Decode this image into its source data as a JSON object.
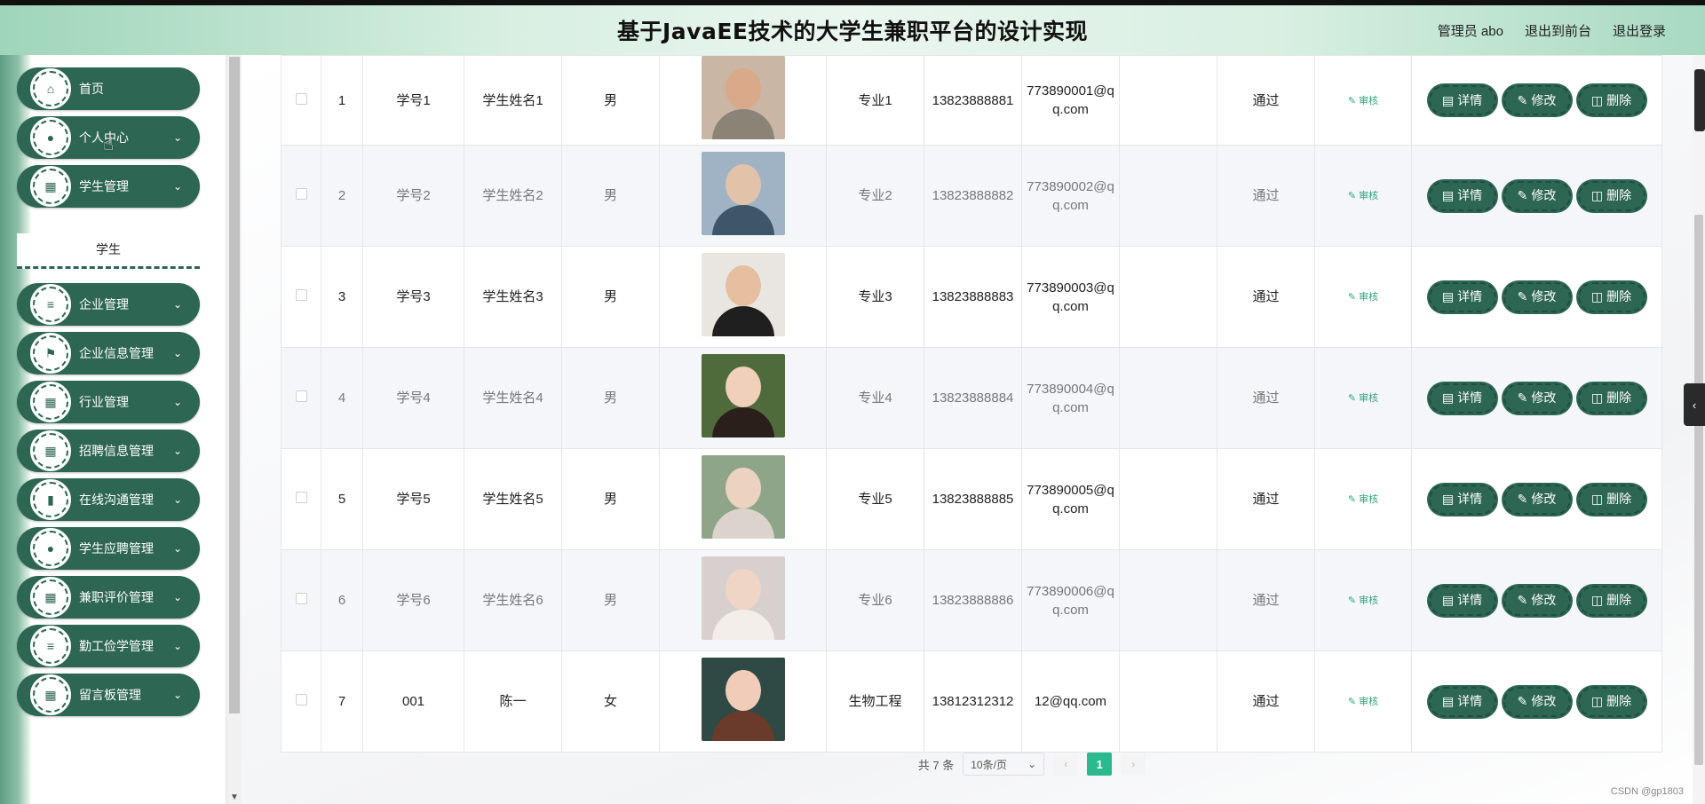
{
  "header": {
    "title": "基于JavaEE技术的大学生兼职平台的设计实现",
    "admin": "管理员 abo",
    "back_front": "退出到前台",
    "logout": "退出登录"
  },
  "sidebar": {
    "items": [
      {
        "label": "首页",
        "icon": "home-icon",
        "chevron": false
      },
      {
        "label": "个人中心",
        "icon": "user-icon",
        "chevron": true
      },
      {
        "label": "学生管理",
        "icon": "grid-icon",
        "chevron": true
      },
      {
        "label": "企业管理",
        "icon": "list-icon",
        "chevron": true
      },
      {
        "label": "企业信息管理",
        "icon": "flag-icon",
        "chevron": true
      },
      {
        "label": "行业管理",
        "icon": "grid-icon",
        "chevron": true
      },
      {
        "label": "招聘信息管理",
        "icon": "grid-icon",
        "chevron": true
      },
      {
        "label": "在线沟通管理",
        "icon": "bar-chart-icon",
        "chevron": true
      },
      {
        "label": "学生应聘管理",
        "icon": "user-icon",
        "chevron": true
      },
      {
        "label": "兼职评价管理",
        "icon": "grid-icon",
        "chevron": true
      },
      {
        "label": "勤工俭学管理",
        "icon": "list-icon",
        "chevron": true
      },
      {
        "label": "留言板管理",
        "icon": "grid-icon",
        "chevron": true
      }
    ],
    "submenu_student": "学生"
  },
  "table": {
    "rows": [
      {
        "no": "1",
        "student_no": "学号1",
        "name": "学生姓名1",
        "gender": "男",
        "major": "专业1",
        "phone": "13823888881",
        "email": "773890001@qq.com",
        "status": "通过",
        "audit": "审核"
      },
      {
        "no": "2",
        "student_no": "学号2",
        "name": "学生姓名2",
        "gender": "男",
        "major": "专业2",
        "phone": "13823888882",
        "email": "773890002@qq.com",
        "status": "通过",
        "audit": "审核"
      },
      {
        "no": "3",
        "student_no": "学号3",
        "name": "学生姓名3",
        "gender": "男",
        "major": "专业3",
        "phone": "13823888883",
        "email": "773890003@qq.com",
        "status": "通过",
        "audit": "审核"
      },
      {
        "no": "4",
        "student_no": "学号4",
        "name": "学生姓名4",
        "gender": "男",
        "major": "专业4",
        "phone": "13823888884",
        "email": "773890004@qq.com",
        "status": "通过",
        "audit": "审核"
      },
      {
        "no": "5",
        "student_no": "学号5",
        "name": "学生姓名5",
        "gender": "男",
        "major": "专业5",
        "phone": "13823888885",
        "email": "773890005@qq.com",
        "status": "通过",
        "audit": "审核"
      },
      {
        "no": "6",
        "student_no": "学号6",
        "name": "学生姓名6",
        "gender": "男",
        "major": "专业6",
        "phone": "13823888886",
        "email": "773890006@qq.com",
        "status": "通过",
        "audit": "审核"
      },
      {
        "no": "7",
        "student_no": "001",
        "name": "陈一",
        "gender": "女",
        "major": "生物工程",
        "phone": "13812312312",
        "email": "12@qq.com",
        "status": "通过",
        "audit": "审核"
      }
    ],
    "actions": {
      "detail": "详情",
      "edit": "修改",
      "delete": "删除"
    }
  },
  "pagination": {
    "total": "共 7 条",
    "page_size": "10条/页",
    "current_page": "1"
  },
  "watermark": "CSDN @gp1803"
}
